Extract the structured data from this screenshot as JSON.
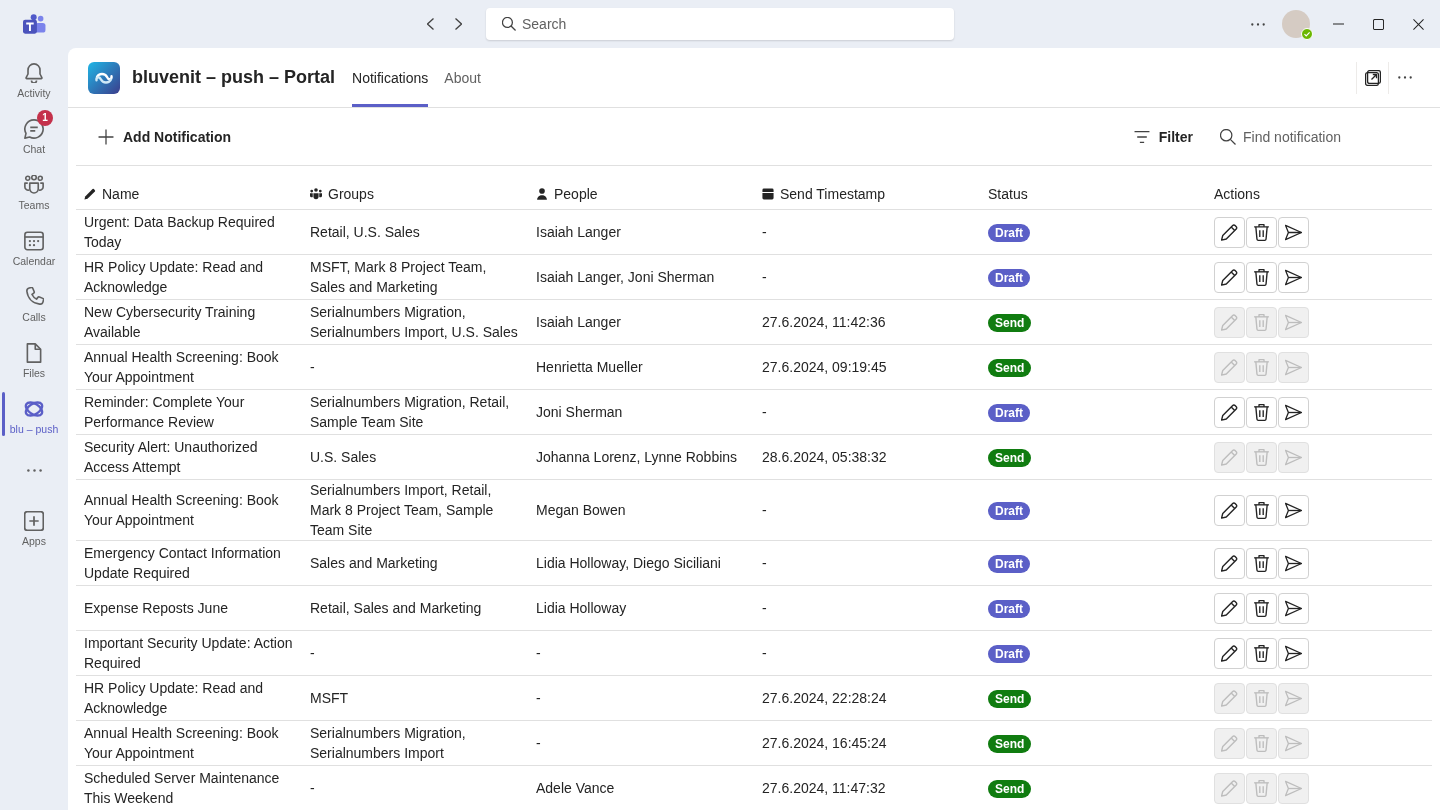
{
  "title_bar": {
    "search": {
      "placeholder": "Search"
    }
  },
  "sidebar": {
    "items": [
      {
        "label": "Activity",
        "selected": false
      },
      {
        "label": "Chat",
        "selected": false,
        "badge": "1"
      },
      {
        "label": "Teams",
        "selected": false
      },
      {
        "label": "Calendar",
        "selected": false
      },
      {
        "label": "Calls",
        "selected": false
      },
      {
        "label": "Files",
        "selected": false
      },
      {
        "label": "blu – push",
        "selected": true
      }
    ],
    "apps": {
      "label": "Apps"
    }
  },
  "app_header": {
    "title": "bluvenit – push – Portal",
    "tabs": [
      {
        "label": "Notifications",
        "selected": true
      },
      {
        "label": "About",
        "selected": false
      }
    ]
  },
  "toolbar": {
    "add_button": "Add Notification",
    "filter_button": "Filter",
    "search": {
      "placeholder": "Find notification"
    }
  },
  "table": {
    "columns": [
      {
        "label": "Name"
      },
      {
        "label": "Groups"
      },
      {
        "label": "People"
      },
      {
        "label": "Send Timestamp"
      },
      {
        "label": "Status"
      },
      {
        "label": "Actions"
      }
    ],
    "rows": [
      {
        "name": "Urgent: Data Backup Required Today",
        "groups": "Retail, U.S. Sales",
        "people": "Isaiah Langer",
        "send_timestamp": "-",
        "status": {
          "label": "Draft",
          "kind": "draft"
        },
        "actions_disabled": false
      },
      {
        "name": "HR Policy Update: Read and Acknowledge",
        "groups": "MSFT, Mark 8 Project Team, Sales and Marketing",
        "people": "Isaiah Langer, Joni Sherman",
        "send_timestamp": "-",
        "status": {
          "label": "Draft",
          "kind": "draft"
        },
        "actions_disabled": false
      },
      {
        "name": "New Cybersecurity Training Available",
        "groups": "Serialnumbers Migration, Serialnumbers Import, U.S. Sales",
        "people": "Isaiah Langer",
        "send_timestamp": "27.6.2024, 11:42:36",
        "status": {
          "label": "Send",
          "kind": "send"
        },
        "actions_disabled": true
      },
      {
        "name": "Annual Health Screening: Book Your Appointment",
        "groups": "-",
        "people": "Henrietta Mueller",
        "send_timestamp": "27.6.2024, 09:19:45",
        "status": {
          "label": "Send",
          "kind": "send"
        },
        "actions_disabled": true
      },
      {
        "name": "Reminder: Complete Your Performance Review",
        "groups": "Serialnumbers Migration, Retail, Sample Team Site",
        "people": "Joni Sherman",
        "send_timestamp": "-",
        "status": {
          "label": "Draft",
          "kind": "draft"
        },
        "actions_disabled": false
      },
      {
        "name": "Security Alert: Unauthorized Access Attempt",
        "groups": "U.S. Sales",
        "people": "Johanna Lorenz, Lynne Robbins",
        "send_timestamp": "28.6.2024, 05:38:32",
        "status": {
          "label": "Send",
          "kind": "send"
        },
        "actions_disabled": true
      },
      {
        "name": "Annual Health Screening: Book Your Appointment",
        "groups": "Serialnumbers Import, Retail, Mark 8 Project Team, Sample Team Site",
        "people": "Megan Bowen",
        "send_timestamp": "-",
        "status": {
          "label": "Draft",
          "kind": "draft"
        },
        "actions_disabled": false
      },
      {
        "name": "Emergency Contact Information Update Required",
        "groups": "Sales and Marketing",
        "people": "Lidia Holloway, Diego Siciliani",
        "send_timestamp": "-",
        "status": {
          "label": "Draft",
          "kind": "draft"
        },
        "actions_disabled": false
      },
      {
        "name": "Expense Reposts June",
        "groups": "Retail, Sales and Marketing",
        "people": "Lidia Holloway",
        "send_timestamp": "-",
        "status": {
          "label": "Draft",
          "kind": "draft"
        },
        "actions_disabled": false
      },
      {
        "name": "Important Security Update: Action Required",
        "groups": "-",
        "people": "-",
        "send_timestamp": "-",
        "status": {
          "label": "Draft",
          "kind": "draft"
        },
        "actions_disabled": false
      },
      {
        "name": "HR Policy Update: Read and Acknowledge",
        "groups": "MSFT",
        "people": "-",
        "send_timestamp": "27.6.2024, 22:28:24",
        "status": {
          "label": "Send",
          "kind": "send"
        },
        "actions_disabled": true
      },
      {
        "name": "Annual Health Screening: Book Your Appointment",
        "groups": "Serialnumbers Migration, Serialnumbers Import",
        "people": "-",
        "send_timestamp": "27.6.2024, 16:45:24",
        "status": {
          "label": "Send",
          "kind": "send"
        },
        "actions_disabled": true
      },
      {
        "name": "Scheduled Server Maintenance This Weekend",
        "groups": "-",
        "people": "Adele Vance",
        "send_timestamp": "27.6.2024, 11:47:32",
        "status": {
          "label": "Send",
          "kind": "send"
        },
        "actions_disabled": true
      }
    ]
  }
}
